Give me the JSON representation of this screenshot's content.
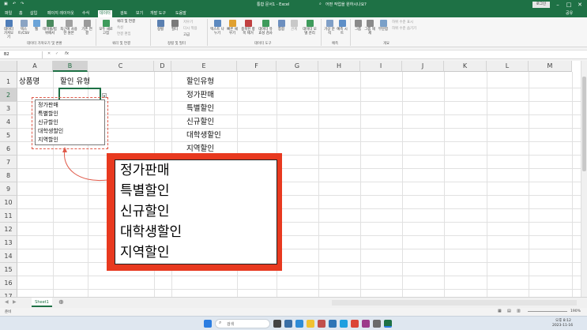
{
  "window": {
    "title": "통합 문서1 - Excel",
    "search_placeholder": "어떤 작업을 원하시나요?",
    "login_label": "로그인",
    "share_label": "공유"
  },
  "ribbon_tabs": [
    "파일",
    "홈",
    "삽입",
    "페이지 레이아웃",
    "수식",
    "데이터",
    "검토",
    "보기",
    "개발 도구",
    "도움말"
  ],
  "active_tab": "데이터",
  "ribbon": {
    "groups": [
      {
        "name": "데이터 가져오기 및 변환",
        "buttons": [
          "데이터 가져오기",
          "텍스트/CSV",
          "웹",
          "테이블/범위에서",
          "최근에 사용한 원본",
          "기존 연결"
        ]
      },
      {
        "name": "쿼리 및 연결",
        "buttons": [
          "모두 새로 고침",
          "쿼리 및 연결",
          "속성",
          "연결 편집"
        ]
      },
      {
        "name": "정렬 및 필터",
        "buttons": [
          "정렬",
          "필터",
          "지우기",
          "다시 적용",
          "고급"
        ]
      },
      {
        "name": "데이터 도구",
        "buttons": [
          "텍스트 나누기",
          "빠른 채우기",
          "중복된 항목 제거",
          "데이터 유효성 검사",
          "통합",
          "관계",
          "데이터 모델 관리"
        ]
      },
      {
        "name": "예측",
        "buttons": [
          "가상 분석",
          "예측 시트"
        ]
      },
      {
        "name": "개요",
        "buttons": [
          "그룹",
          "그룹 해제",
          "부분합",
          "하위 수준 표시",
          "하위 수준 숨기기"
        ]
      }
    ]
  },
  "formula_bar": {
    "name_box": "B2",
    "fx_label": "fx",
    "content": ""
  },
  "columns": [
    "A",
    "B",
    "C",
    "D",
    "E",
    "F",
    "G",
    "H",
    "I",
    "J",
    "K",
    "L",
    "M"
  ],
  "rows": [
    "1",
    "2",
    "3",
    "4",
    "5",
    "6",
    "7",
    "8",
    "9",
    "10",
    "11",
    "12",
    "13",
    "14",
    "15",
    "16",
    "17"
  ],
  "cells": {
    "A1": "상품명",
    "B1": "할인 유형",
    "E1": "할인유형",
    "E2": "정가판매",
    "E3": "특별할인",
    "E4": "신규할인",
    "E5": "대학생할인",
    "E6": "지역할인"
  },
  "dropdown_options": [
    "정가판매",
    "특별할인",
    "신규할인",
    "대학생할인",
    "지역할인"
  ],
  "callout_options": [
    "정가판매",
    "특별할인",
    "신규할인",
    "대학생할인",
    "지역할인"
  ],
  "sheet_tabs": [
    "Sheet1"
  ],
  "status": {
    "ready": "준비",
    "zoom": "190%"
  },
  "taskbar": {
    "search_placeholder": "검색",
    "time": "오후 8:12",
    "date": "2023-11-16"
  },
  "colors": {
    "excel_green": "#1e7145",
    "callout_red": "#e8391f",
    "dashed_red": "#e05a4a"
  }
}
